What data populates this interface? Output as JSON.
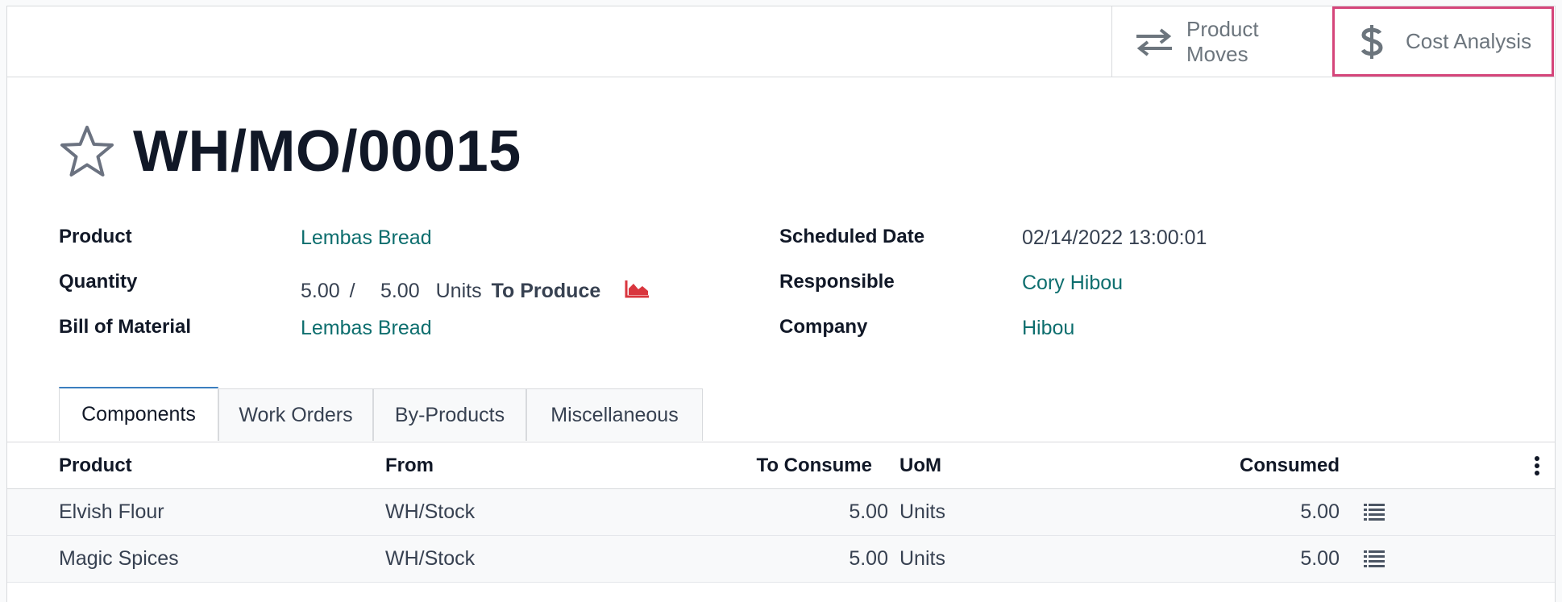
{
  "buttons": {
    "product_moves": "Product Moves",
    "cost_analysis": "Cost Analysis"
  },
  "record": {
    "name": "WH/MO/00015"
  },
  "fields": {
    "product": {
      "label": "Product",
      "value": "Lembas Bread"
    },
    "quantity": {
      "label": "Quantity",
      "produced": "5.00",
      "separator": "/",
      "qty": "5.00",
      "uom": "Units",
      "suffix": "To Produce"
    },
    "bom": {
      "label": "Bill of Material",
      "value": "Lembas Bread"
    },
    "scheduled_date": {
      "label": "Scheduled Date",
      "value": "02/14/2022 13:00:01"
    },
    "responsible": {
      "label": "Responsible",
      "value": "Cory Hibou"
    },
    "company": {
      "label": "Company",
      "value": "Hibou"
    }
  },
  "tabs": [
    {
      "label": "Components",
      "active": true
    },
    {
      "label": "Work Orders"
    },
    {
      "label": "By-Products"
    },
    {
      "label": "Miscellaneous"
    }
  ],
  "table": {
    "headers": [
      "Product",
      "From",
      "To Consume",
      "UoM",
      "Consumed"
    ],
    "rows": [
      {
        "product": "Elvish Flour",
        "from": "WH/Stock",
        "to_consume": "5.00",
        "uom": "Units",
        "consumed": "5.00"
      },
      {
        "product": "Magic Spices",
        "from": "WH/Stock",
        "to_consume": "5.00",
        "uom": "Units",
        "consumed": "5.00"
      }
    ]
  },
  "colors": {
    "link": "#0d6e6e",
    "highlight": "#d5457a",
    "forecast_icon": "#d9363e"
  },
  "icons": [
    "arrows-exchange-icon",
    "dollar-icon",
    "star-icon",
    "area-chart-icon",
    "list-detail-icon",
    "kebab-menu-icon"
  ]
}
